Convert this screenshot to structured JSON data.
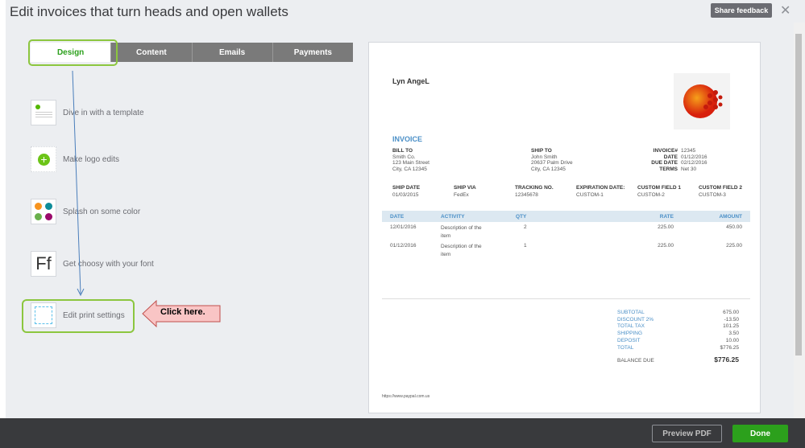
{
  "header": {
    "title": "Edit invoices that turn heads and open wallets",
    "feedback": "Share feedback",
    "close": "✕"
  },
  "tabs": [
    "Design",
    "Content",
    "Emails",
    "Payments"
  ],
  "design_items": [
    "Dive in with a template",
    "Make logo edits",
    "Splash on some color",
    "Get choosy with your font",
    "Edit print settings"
  ],
  "font_icon_text": "Ff",
  "callout": "Click here.",
  "invoice": {
    "company": "Lyn AngeL",
    "title": "INVOICE",
    "bill_to": {
      "label": "BILL TO",
      "l1": "Smith Co.",
      "l2": "123 Main Street",
      "l3": "City, CA 12345"
    },
    "ship_to": {
      "label": "SHIP TO",
      "l1": "John Smith",
      "l2": "20637 Palm Drive",
      "l3": "City, CA 12345"
    },
    "meta": [
      {
        "k": "INVOICE#",
        "v": "12345"
      },
      {
        "k": "DATE",
        "v": "01/12/2016"
      },
      {
        "k": "DUE DATE",
        "v": "02/12/2016"
      },
      {
        "k": "TERMS",
        "v": "Net 30"
      }
    ],
    "fields": [
      {
        "k": "SHIP DATE",
        "v": "01/03/2015"
      },
      {
        "k": "SHIP VIA",
        "v": "FedEx"
      },
      {
        "k": "TRACKING NO.",
        "v": "12345678"
      },
      {
        "k": "EXPIRATION DATE:",
        "v": "CUSTOM-1"
      },
      {
        "k": "CUSTOM FIELD 1",
        "v": "CUSTOM-2"
      },
      {
        "k": "CUSTOM FIELD 2",
        "v": "CUSTOM-3"
      }
    ],
    "columns": [
      "DATE",
      "ACTIVITY",
      "QTY",
      "RATE",
      "AMOUNT"
    ],
    "rows": [
      [
        "12/01/2016",
        "Description of the item",
        "2",
        "225.00",
        "450.00"
      ],
      [
        "01/12/2016",
        "Description of the item",
        "1",
        "225.00",
        "225.00"
      ]
    ],
    "totals": [
      {
        "k": "SUBTOTAL",
        "v": "675.00"
      },
      {
        "k": "DISCOUNT 2%",
        "v": "-13.50"
      },
      {
        "k": "TOTAL TAX",
        "v": "101.25"
      },
      {
        "k": "SHIPPING",
        "v": "3.50"
      },
      {
        "k": "DEPOSIT",
        "v": "10.00"
      },
      {
        "k": "TOTAL",
        "v": "$776.25"
      }
    ],
    "balance_label": "BALANCE DUE",
    "balance": "$776.25",
    "footer": "https://www.paypal.com.us"
  },
  "footer": {
    "preview": "Preview PDF",
    "done": "Done"
  }
}
